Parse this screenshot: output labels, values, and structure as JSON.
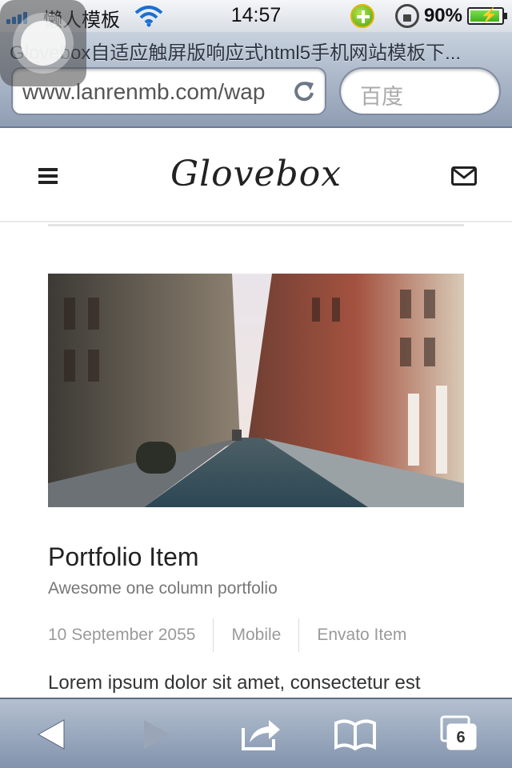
{
  "status_bar": {
    "carrier": "懒人模板",
    "time": "14:57",
    "battery_percent": "90%",
    "battery_level": 0.9
  },
  "browser": {
    "page_title": "Glovebox自适应触屏版响应式html5手机网站模板下...",
    "url": "www.lanrenmb.com/wap",
    "search_placeholder": "百度",
    "tab_count": "6"
  },
  "site": {
    "logo": "Glovebox"
  },
  "portfolio": {
    "title": "Portfolio Item",
    "subtitle": "Awesome one column portfolio",
    "meta": {
      "date": "10 September 2055",
      "category": "Mobile",
      "source": "Envato Item"
    },
    "body_preview": "Lorem ipsum dolor sit amet, consectetur est"
  },
  "colors": {
    "accent": "#1b6fd1",
    "text_dark": "#222222",
    "text_muted": "#9a9a9a"
  },
  "icons": [
    "signal-icon",
    "wifi-icon",
    "plus-icon",
    "rotation-lock-icon",
    "battery-icon",
    "reload-icon",
    "menu-icon",
    "mail-icon",
    "back-icon",
    "forward-icon",
    "share-icon",
    "bookmarks-icon",
    "tabs-icon"
  ]
}
